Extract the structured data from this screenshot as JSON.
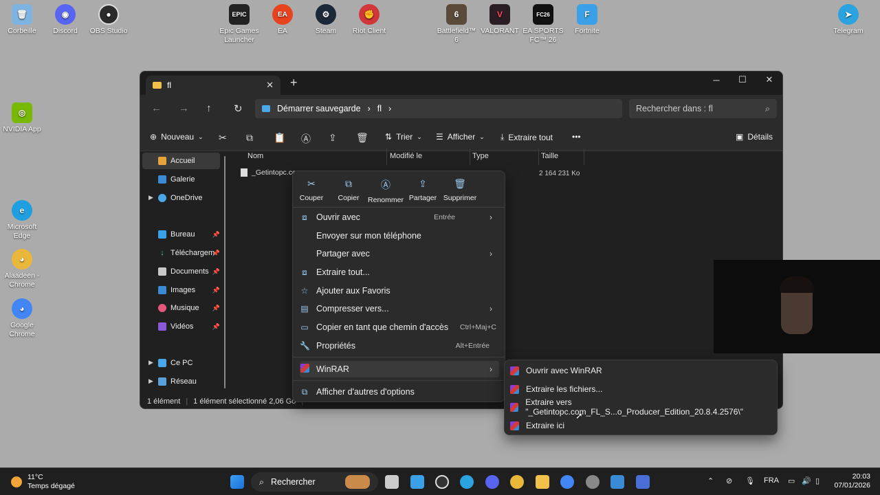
{
  "desktop": {
    "icons": [
      {
        "label": "Corbeille",
        "color": "#7fb3e0"
      },
      {
        "label": "Discord",
        "color": "#5865f2"
      },
      {
        "label": "OBS Studio",
        "color": "#2b2b2b"
      },
      {
        "label": "Epic Games Launcher",
        "color": "#222222"
      },
      {
        "label": "EA",
        "color": "#e8431f"
      },
      {
        "label": "Steam",
        "color": "#1b2838"
      },
      {
        "label": "Riot Client",
        "color": "#d13639"
      },
      {
        "label": "Battlefield™ 6",
        "color": "#5a4a3a"
      },
      {
        "label": "VALORANT",
        "color": "#2a1d24"
      },
      {
        "label": "EA SPORTS FC™ 26",
        "color": "#111111"
      },
      {
        "label": "Fortnite",
        "color": "#3aa0e8"
      },
      {
        "label": "Telegram",
        "color": "#2aa3e0"
      },
      {
        "label": "NVIDIA App",
        "color": "#76b900"
      },
      {
        "label": "Microsoft Edge",
        "color": "#1f9fe0"
      },
      {
        "label": "Alaadeen - Chrome",
        "color": "#e9b83a"
      },
      {
        "label": "Google Chrome",
        "color": "#4285f4"
      }
    ]
  },
  "explorer": {
    "tab_title": "fl",
    "breadcrumb": [
      "Démarrer sauvegarde",
      "fl"
    ],
    "search_placeholder": "Rechercher dans : fl",
    "toolbar": {
      "new": "Nouveau",
      "sort": "Trier",
      "view": "Afficher",
      "extract_all": "Extraire tout",
      "more": "•••",
      "details": "Détails"
    },
    "sidebar": {
      "home": "Accueil",
      "gallery": "Galerie",
      "onedrive": "OneDrive",
      "desktop": "Bureau",
      "downloads": "Téléchargem",
      "documents": "Documents",
      "pictures": "Images",
      "music": "Musique",
      "videos": "Vidéos",
      "this_pc": "Ce PC",
      "network": "Réseau"
    },
    "columns": {
      "name": "Nom",
      "modified": "Modifié le",
      "type": "Type",
      "size": "Taille"
    },
    "file": {
      "name": "_Getintopc.cc",
      "size": "2 164 231 Ko"
    },
    "status": {
      "count": "1 élément",
      "selected": "1 élément sélectionné  2,06 Go"
    }
  },
  "context_menu": {
    "quick_actions": [
      "Couper",
      "Copier",
      "Renommer",
      "Partager",
      "Supprimer"
    ],
    "items": {
      "open_with": "Ouvrir avec",
      "open_with_shortcut": "Entrée",
      "send_phone": "Envoyer sur mon téléphone",
      "share_with": "Partager avec",
      "extract_all": "Extraire tout...",
      "add_fav": "Ajouter aux Favoris",
      "compress": "Compresser vers...",
      "copy_path": "Copier en tant que chemin d'accès",
      "copy_path_shortcut": "Ctrl+Maj+C",
      "properties": "Propriétés",
      "properties_shortcut": "Alt+Entrée",
      "winrar": "WinRAR",
      "more_options": "Afficher d'autres d'options"
    }
  },
  "winrar_submenu": {
    "open": "Ouvrir avec WinRAR",
    "extract_files": "Extraire les fichiers...",
    "extract_to": "Extraire vers \"_Getintopc.com_FL_S...o_Producer_Edition_20.8.4.2576\\\"",
    "extract_here": "Extraire ici"
  },
  "taskbar": {
    "weather_temp": "11°C",
    "weather_desc": "Temps dégagé",
    "search": "Rechercher",
    "language": "FRA",
    "time": "20:03",
    "date": "07/01/2026"
  }
}
